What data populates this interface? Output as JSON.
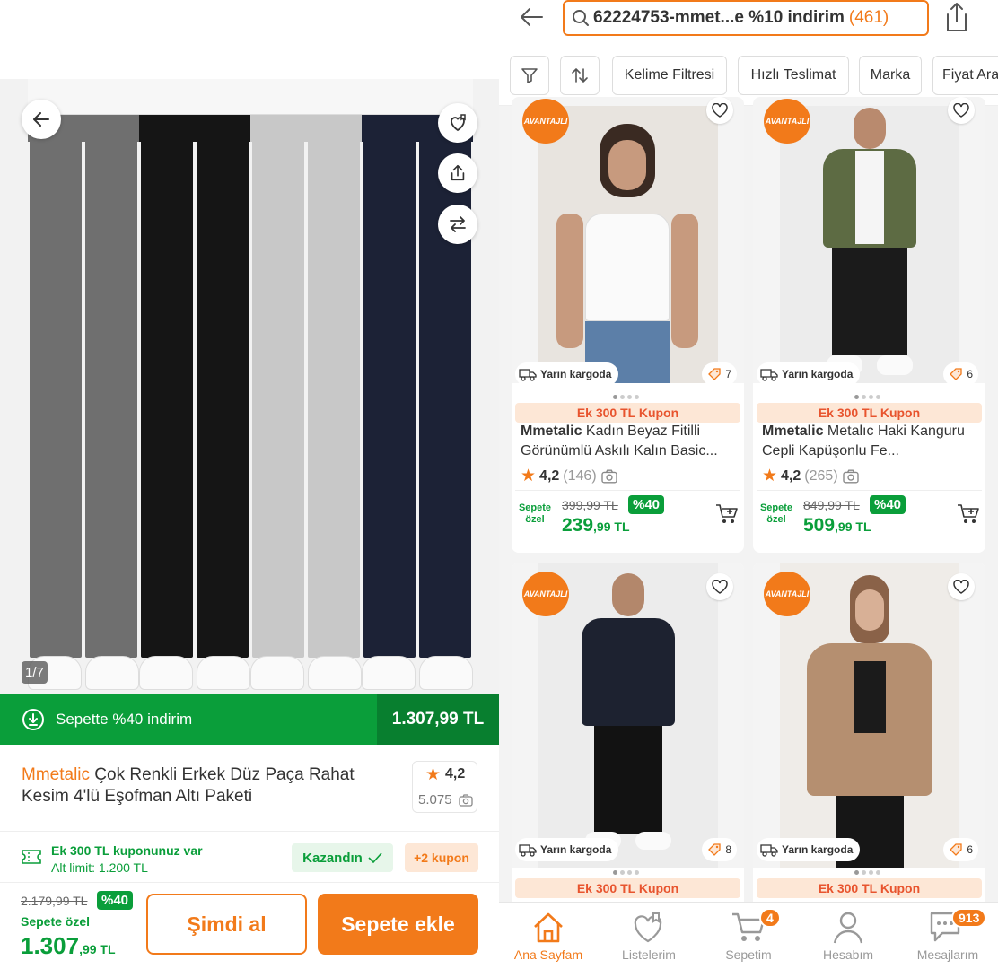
{
  "product": {
    "image_counter": "1/7",
    "promo_text": "Sepette %40 indirim",
    "promo_price": "1.307,99 TL",
    "brand": "Mmetalic",
    "title": "Çok Renkli Erkek Düz Paça Rahat Kesim 4'lü Eşofman Altı Paketi",
    "rating": "4,2",
    "review_count": "5.075",
    "coupon_title": "Ek 300 TL kuponunuz var",
    "coupon_limit": "Alt limit: 1.200 TL",
    "won_label": "Kazandın",
    "more_coupons": "+2 kupon",
    "old_price": "2.179,99 TL",
    "discount": "%40",
    "special_label": "Sepete özel",
    "new_price_main": "1.307",
    "new_price_rest": ",99 TL",
    "buy_now": "Şimdi al",
    "add_to_cart": "Sepete ekle",
    "pant_colors": [
      "#6f6f6f",
      "#151515",
      "#c8c8c8",
      "#1c2236"
    ]
  },
  "search": {
    "query": "62224753-mmet...e %10 indirim",
    "result_count": "(461)"
  },
  "filters": [
    "Kelime Filtresi",
    "Hızlı Teslimat",
    "Marka",
    "Fiyat Ara"
  ],
  "cards": [
    {
      "badge": "AVANTAJLI",
      "cargo": "Yarın kargoda",
      "count": "7",
      "coupon": "Ek 300 TL Kupon",
      "brand": "Mmetalic",
      "name": "Kadın Beyaz Fitilli Görünümlü Askılı Kalın Basic...",
      "rating": "4,2",
      "reviews": "(146)",
      "special": "Sepete özel",
      "old_price": "399,99 TL",
      "discount": "%40",
      "price_main": "239",
      "price_rest": ",99 TL"
    },
    {
      "badge": "AVANTAJLI",
      "cargo": "Yarın kargoda",
      "count": "6",
      "coupon": "Ek 300 TL Kupon",
      "brand": "Mmetalic",
      "name": "Metalıc Haki Kanguru Cepli Kapüşonlu Fe...",
      "rating": "4,2",
      "reviews": "(265)",
      "special": "Sepete özel",
      "old_price": "849,99 TL",
      "discount": "%40",
      "price_main": "509",
      "price_rest": ",99 TL"
    },
    {
      "badge": "AVANTAJLI",
      "cargo": "Yarın kargoda",
      "count": "8",
      "coupon": "Ek 300 TL Kupon"
    },
    {
      "badge": "AVANTAJLI",
      "cargo": "Yarın kargoda",
      "count": "6",
      "coupon": "Ek 300 TL Kupon"
    }
  ],
  "tabs": [
    {
      "label": "Ana Sayfam",
      "badge": ""
    },
    {
      "label": "Listelerim",
      "badge": ""
    },
    {
      "label": "Sepetim",
      "badge": "4"
    },
    {
      "label": "Hesabım",
      "badge": ""
    },
    {
      "label": "Mesajlarım",
      "badge": "913"
    }
  ],
  "colors": {
    "accent": "#f27a1a",
    "green": "#0a9e3a"
  }
}
